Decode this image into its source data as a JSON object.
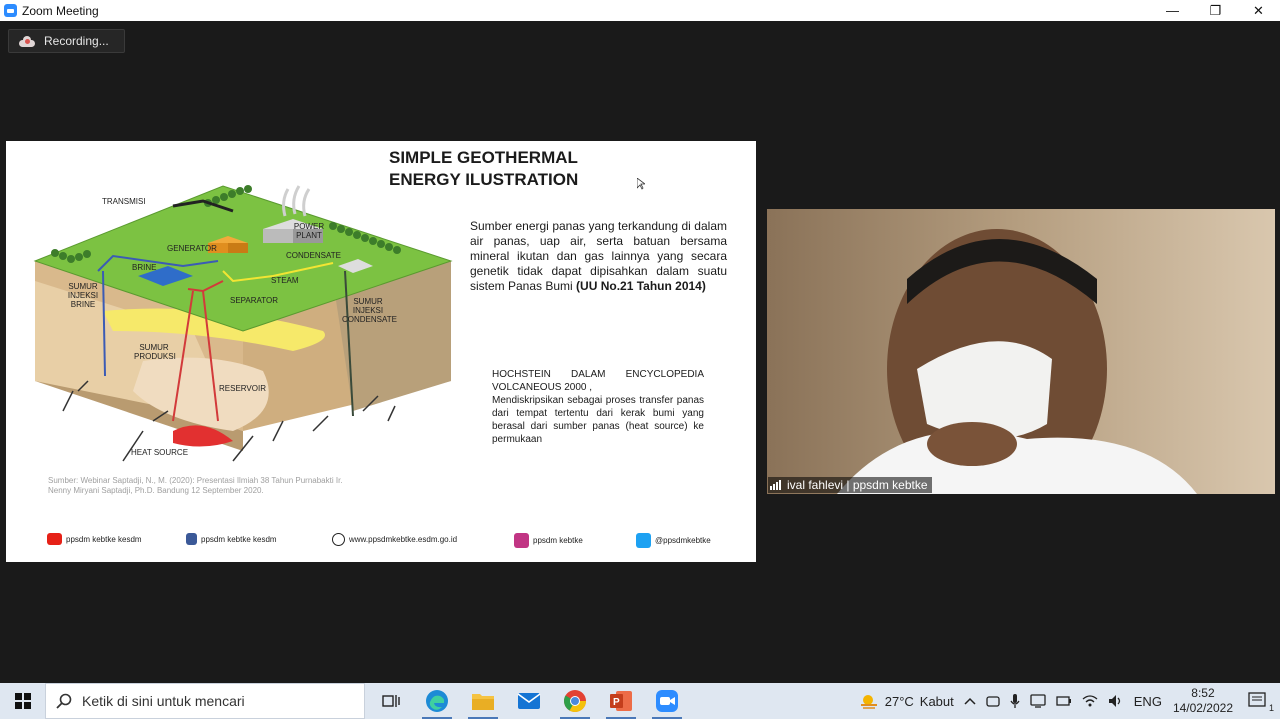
{
  "window": {
    "title": "Zoom Meeting",
    "minimize_glyph": "—",
    "restore_glyph": "❐",
    "close_glyph": "✕"
  },
  "recording": {
    "label": "Recording..."
  },
  "slide": {
    "title_line1": "SIMPLE GEOTHERMAL",
    "title_line2": "ENERGY ILUSTRATION",
    "paragraph1": "Sumber energi panas yang terkandung di dalam air panas, uap air, serta batuan bersama mineral ikutan dan gas lainnya yang secara genetik tidak dapat dipisahkan dalam suatu sistem Panas Bumi ",
    "paragraph1_bold": "(UU No.21 Tahun 2014)",
    "paragraph2_line1": "HOCHSTEIN DALAM ENCYCLOPEDIA VOLCANEOUS 2000 ,",
    "paragraph2_line2": "Mendiskripsikan sebagai proses transfer panas dari tempat tertentu dari kerak bumi yang berasal dari sumber panas (heat source) ke permukaan",
    "source": "Sumber: Webinar Saptadji, N., M. (2020): Presentasi Ilmiah 38 Tahun Purnabakti Ir. Nenny Miryani Saptadji, Ph.D. Bandung 12 September 2020.",
    "diagram_labels": {
      "transmisi": "TRANSMISI",
      "generator": "GENERATOR",
      "power_plant": "POWER PLANT",
      "condensate": "CONDENSATE",
      "brine": "BRINE",
      "steam": "STEAM",
      "separator": "SEPARATOR",
      "sumur_injeksi_brine": "SUMUR INJEKSI BRINE",
      "sumur_injeksi_condensate": "SUMUR INJEKSI CONDENSATE",
      "sumur_produksi": "SUMUR PRODUKSI",
      "reservoir": "RESERVOIR",
      "heat_source": "HEAT SOURCE"
    },
    "socials": [
      {
        "icon": "youtube-icon",
        "label": "ppsdm kebtke kesdm",
        "color": "#e62117"
      },
      {
        "icon": "facebook-icon",
        "label": "ppsdm kebtke kesdm",
        "color": "#3b5998"
      },
      {
        "icon": "globe-icon",
        "label": "www.ppsdmkebtke.esdm.go.id",
        "color": "#222222"
      },
      {
        "icon": "instagram-icon",
        "label": "ppsdm kebtke",
        "color": "#c13584"
      },
      {
        "icon": "twitter-icon",
        "label": "@ppsdmkebtke",
        "color": "#1da1f2"
      }
    ]
  },
  "participant": {
    "name": "ival fahlevi | ppsdm kebtke"
  },
  "taskbar": {
    "search_placeholder": "Ketik di sini untuk mencari",
    "apps": [
      "task-view-icon",
      "edge-icon",
      "file-explorer-icon",
      "mail-icon",
      "chrome-icon",
      "powerpoint-icon",
      "zoom-icon"
    ],
    "weather_temp": "27°C",
    "weather_desc": "Kabut",
    "language": "ENG",
    "time": "8:52",
    "date": "14/02/2022",
    "notification_count": "1"
  },
  "colors": {
    "accent_zoom": "#2d8cff",
    "taskbar_bg": "#dfe7f1",
    "meeting_bg": "#1a1a1a"
  }
}
